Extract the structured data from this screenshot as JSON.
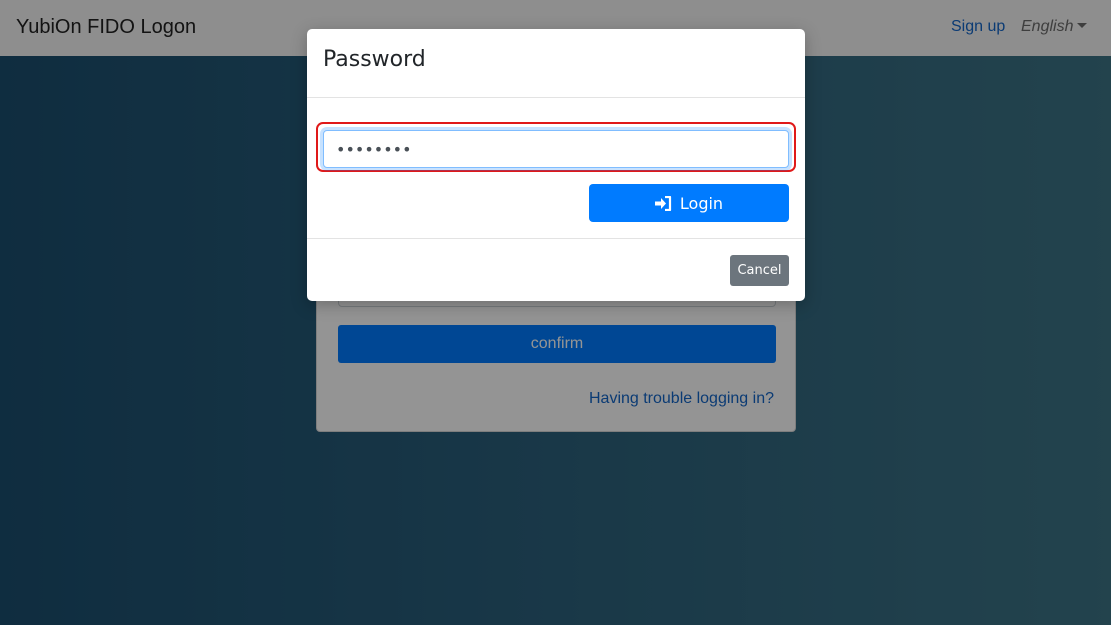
{
  "navbar": {
    "brand": "YubiOn FIDO Logon",
    "signup": "Sign up",
    "language": "English"
  },
  "card": {
    "confirm_label": "confirm",
    "trouble_link": "Having trouble logging in?"
  },
  "modal": {
    "title": "Password",
    "password_value": "••••••••",
    "login_label": "Login",
    "cancel_label": "Cancel"
  },
  "colors": {
    "primary": "#007bff",
    "secondary": "#6c757d",
    "highlight": "#e01919"
  },
  "icons": {
    "login": "sign-in-icon",
    "language_menu": "caret-down-icon"
  }
}
